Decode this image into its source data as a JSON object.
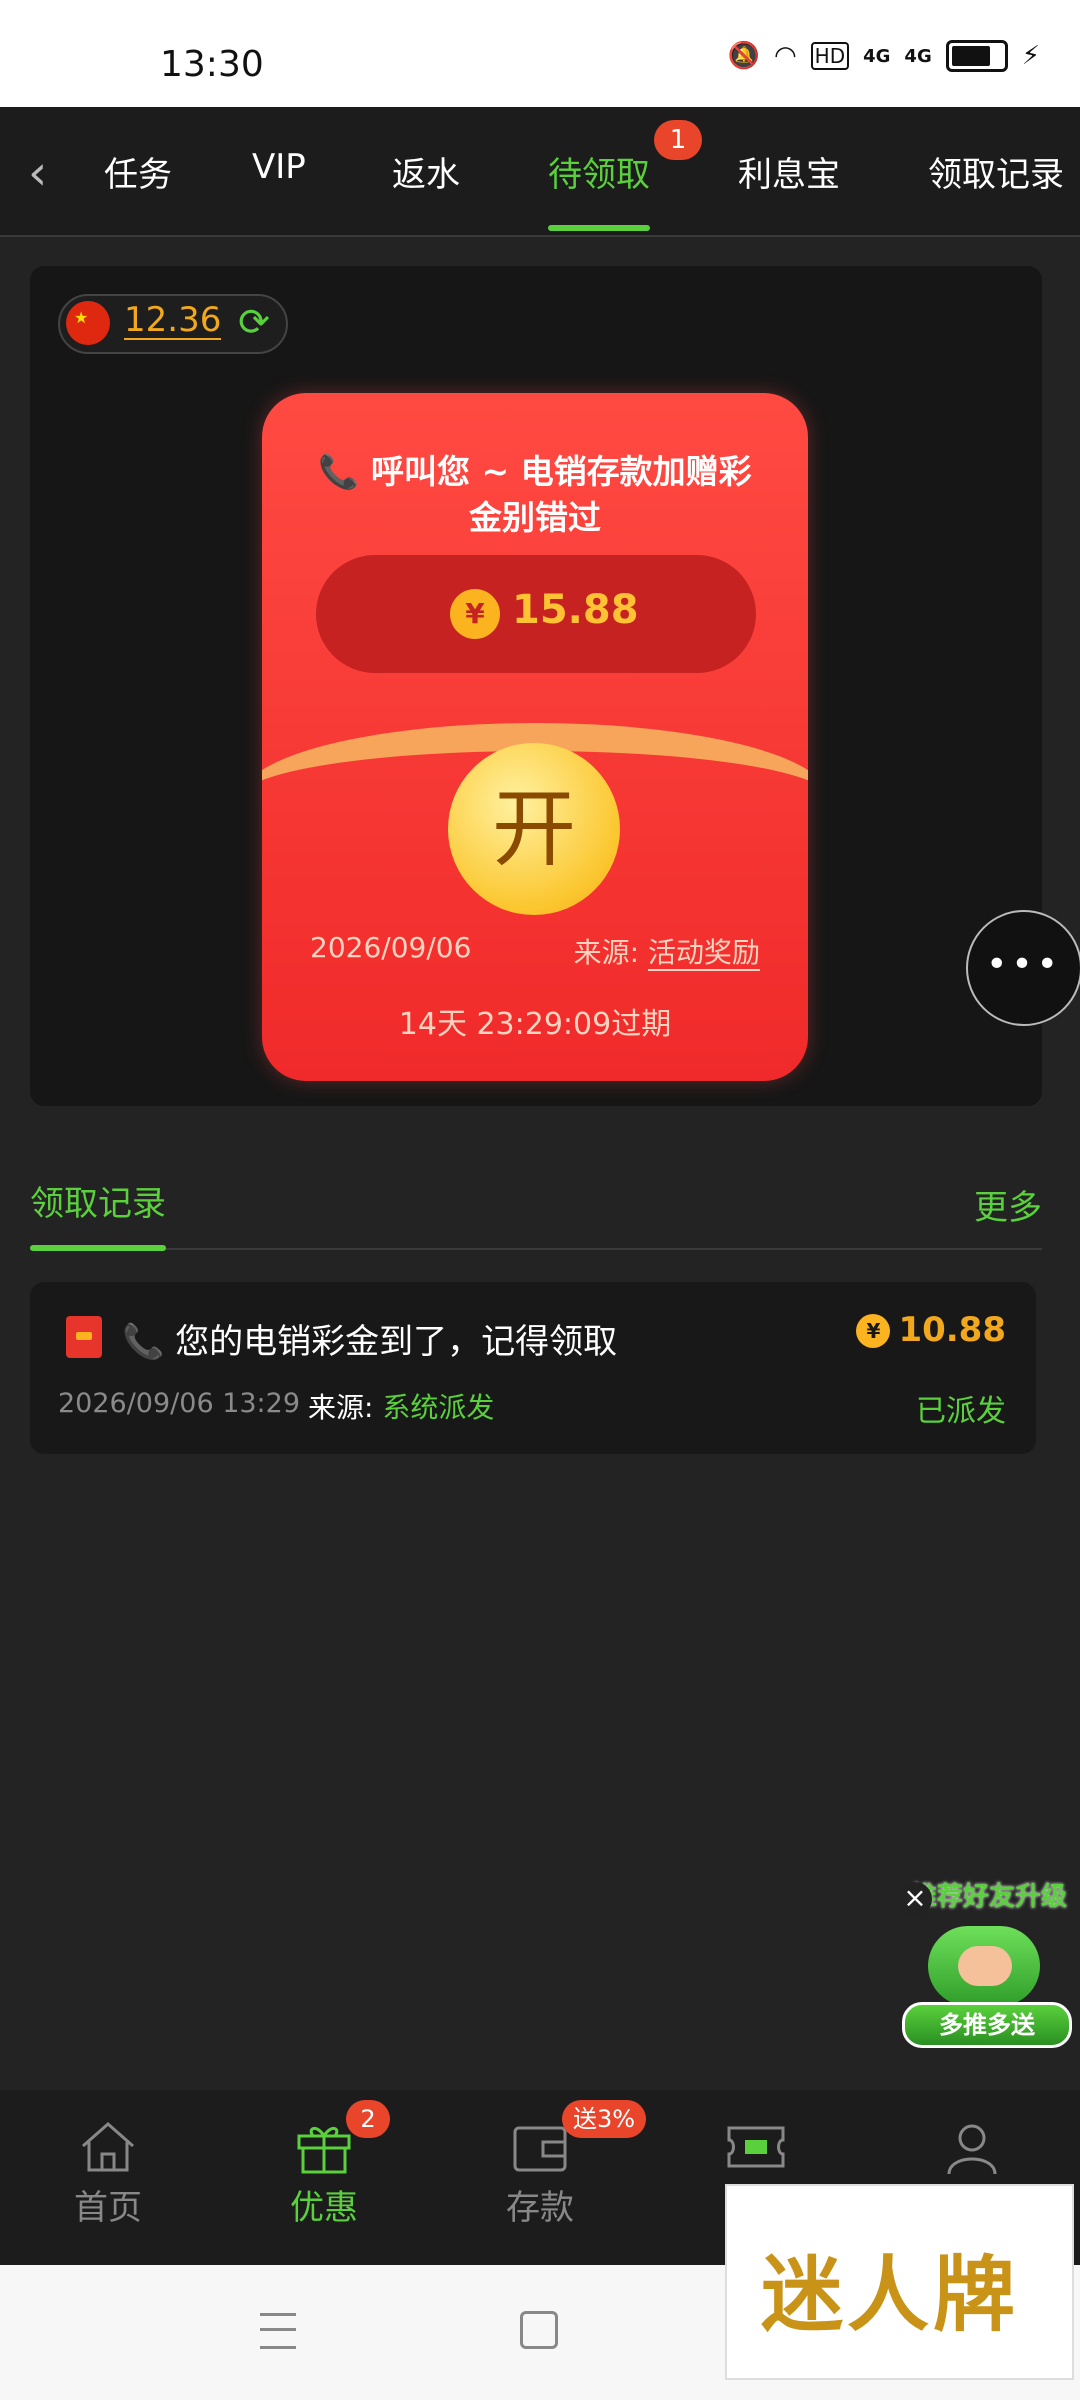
{
  "status_bar": {
    "time": "13:30",
    "icons": [
      "mute-icon",
      "wifi-icon",
      "hd-icon",
      "signal-4g-icon",
      "signal-4g-icon",
      "battery-icon",
      "charging-icon"
    ],
    "hd": "HD",
    "net1": "4G",
    "net2": "4G"
  },
  "top_nav": {
    "tabs": [
      {
        "label": "任务"
      },
      {
        "label": "VIP"
      },
      {
        "label": "返水"
      },
      {
        "label": "待领取",
        "badge": "1"
      },
      {
        "label": "利息宝"
      },
      {
        "label": "领取记录"
      }
    ],
    "active_tab": "待领取"
  },
  "balance": {
    "value": "12.36"
  },
  "red_packet": {
    "title": "📞 呼叫您 ~ 电销存款加赠彩金别错过",
    "amount": "15.88",
    "currency_symbol": "¥",
    "open_label": "开",
    "date": "2026/09/06",
    "source_label": "来源:",
    "source_value": "活动奖励",
    "expire": "14天 23:29:09过期"
  },
  "records": {
    "title": "领取记录",
    "more": "更多",
    "items": [
      {
        "title": "📞 您的电销彩金到了，记得领取",
        "amount": "10.88",
        "time": "2026/09/06 13:29",
        "source_label": "来源:",
        "source_value": "系统派发",
        "status": "已派发"
      }
    ]
  },
  "promo": {
    "top": "推荐好友升级",
    "button": "多推多送"
  },
  "bottom_nav": {
    "items": [
      {
        "label": "首页"
      },
      {
        "label": "优惠",
        "badge": "2"
      },
      {
        "label": "存款",
        "badge": "送3%"
      },
      {
        "label": ""
      },
      {
        "label": ""
      }
    ],
    "active": "优惠"
  },
  "watermark": "迷人牌",
  "colors": {
    "accent": "#5ad13c",
    "gold": "#f2a81c",
    "red": "#f02a2a",
    "badge": "#e8452b"
  }
}
